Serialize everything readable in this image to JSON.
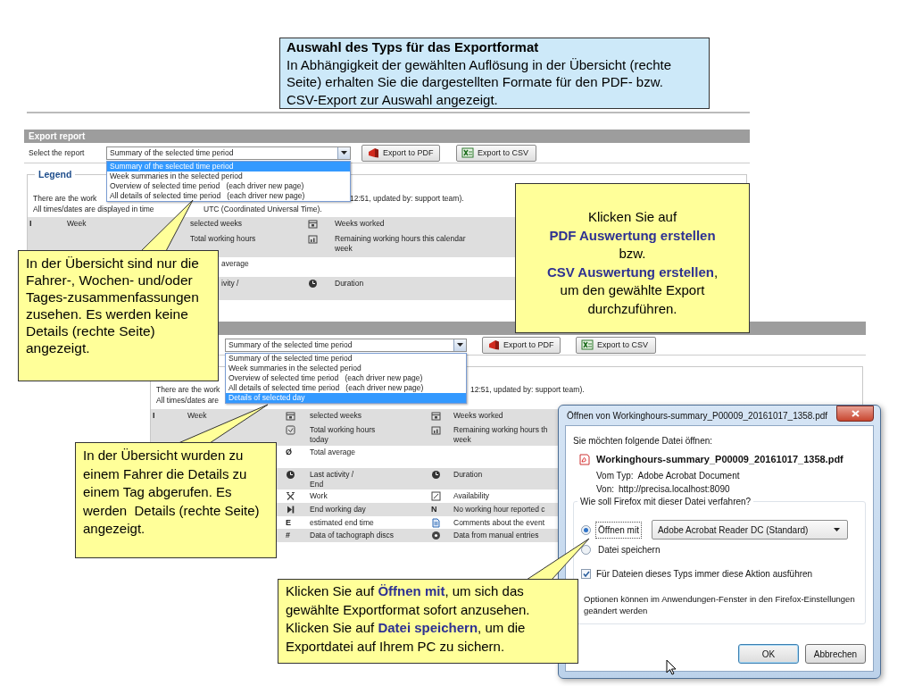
{
  "note": {
    "title": "Auswahl des Typs für das Exportformat",
    "text": "In Abhängigkeit der gewählten Auflösung in der Übersicht (rechte Seite) erhalten Sie die dargestellten Formate für den PDF- bzw. CSV-Export zur Auswahl angezeigt."
  },
  "screens": [
    {
      "header": "Export report",
      "select_label": "Select the report",
      "select_value": "Summary of the selected time period",
      "buttons": [
        {
          "kind": "pdf",
          "label": "Export to PDF"
        },
        {
          "kind": "csv",
          "label": "Export to CSV"
        }
      ],
      "dropdown": [
        {
          "label": "Summary of the selected time period",
          "selected": true
        },
        {
          "label": "Week summaries in the selected period",
          "selected": false
        },
        {
          "label": "Overview of selected time period   (each driver new page)",
          "selected": false
        },
        {
          "label": "All details of selected time period   (each driver new page)",
          "selected": false
        }
      ],
      "legend_title": "Legend",
      "info_lines": [
        [
          "There are the work",
          "12:51, updated by: support team)."
        ],
        [
          "All times/dates are displayed in time",
          "UTC (Coordinated Universal Time)."
        ]
      ],
      "rows": [
        {
          "shaded": true,
          "first": {
            "icon": {
              "kind": "glyph",
              "text": "I"
            },
            "label": "Week"
          },
          "second": {
            "label": "selected weeks"
          },
          "third": {
            "icon": {
              "kind": "calendar"
            },
            "label": "Weeks worked"
          }
        },
        {
          "shaded": true,
          "second": {
            "label": "Total working hours"
          },
          "third": {
            "icon": {
              "kind": "chart"
            },
            "label": "Remaining working hours this calendar\nweek"
          }
        },
        {
          "shaded": false,
          "second": {
            "label": "average"
          }
        },
        {
          "shaded": true,
          "second": {
            "label": "ivity /"
          },
          "third": {
            "icon": {
              "kind": "clock"
            },
            "label": "Duration"
          }
        }
      ]
    },
    {
      "select_value": "Summary of the selected time period",
      "buttons": [
        {
          "kind": "pdf",
          "label": "Export to PDF"
        },
        {
          "kind": "csv",
          "label": "Export to CSV"
        }
      ],
      "dropdown": [
        {
          "label": "Summary of the selected time period",
          "selected": false
        },
        {
          "label": "Week summaries in the selected period",
          "selected": false
        },
        {
          "label": "Overview of selected time period   (each driver new page)",
          "selected": false
        },
        {
          "label": "All details of selected time period   (each driver new page)",
          "selected": false
        },
        {
          "label": "Details of selected day",
          "selected": true
        }
      ],
      "info_lines": [
        [
          "There are the work",
          "12:51, updated by: support team)."
        ],
        [
          "All times/dates are"
        ]
      ],
      "rows": [
        {
          "shaded": true,
          "first": {
            "icon": {
              "kind": "glyph",
              "text": "I"
            },
            "label": "Week"
          },
          "second": {
            "icon": {
              "kind": "calendar"
            },
            "label": "selected weeks"
          },
          "third": {
            "icon": {
              "kind": "calendar"
            },
            "label": "Weeks worked"
          }
        },
        {
          "shaded": true,
          "second": {
            "icon": {
              "kind": "checkbox"
            },
            "label": "Total working hours\ntoday"
          },
          "third": {
            "icon": {
              "kind": "chart"
            },
            "label": "Remaining working hours th\nweek"
          }
        },
        {
          "shaded": false,
          "second": {
            "icon": {
              "kind": "glyph",
              "text": "Ø"
            },
            "label": "Total average"
          }
        },
        {
          "shaded": true,
          "second": {
            "icon": {
              "kind": "clock"
            },
            "label": "Last activity /\nEnd"
          },
          "third": {
            "icon": {
              "kind": "clock"
            },
            "label": "Duration"
          }
        },
        {
          "shaded": false,
          "second": {
            "icon": {
              "kind": "tools"
            },
            "label": "Work"
          },
          "third": {
            "icon": {
              "kind": "box"
            },
            "label": "Availability"
          }
        },
        {
          "shaded": true,
          "second": {
            "icon": {
              "kind": "end"
            },
            "label": "End working day"
          },
          "third": {
            "icon": {
              "kind": "glyph",
              "text": "N"
            },
            "label": "No working hour reported c"
          }
        },
        {
          "shaded": false,
          "second": {
            "icon": {
              "kind": "glyph",
              "text": "E"
            },
            "label": "estimated end time"
          },
          "third": {
            "icon": {
              "kind": "doc"
            },
            "label": "Comments about the event"
          }
        },
        {
          "shaded": true,
          "second": {
            "icon": {
              "kind": "glyph",
              "text": "#"
            },
            "label": "Data of tachograph discs"
          },
          "third": {
            "icon": {
              "kind": "disc"
            },
            "label": "Data from manual entries"
          }
        }
      ]
    }
  ],
  "dialog": {
    "title": "Öffnen von Workinghours-summary_P00009_20161017_1358.pdf",
    "prompt": "Sie möchten folgende Datei öffnen:",
    "file_name": "Workinghours-summary_P00009_20161017_1358.pdf",
    "type_label": "Vom Typ:",
    "type_value": "Adobe Acrobat Document",
    "from_label": "Von:",
    "from_value": "http://precisa.localhost:8090",
    "question": "Wie soll Firefox mit dieser Datei verfahren?",
    "options": [
      {
        "label": "Öffnen mit",
        "selected": true
      },
      {
        "label": "Datei speichern",
        "selected": false
      }
    ],
    "app_select": "Adobe Acrobat Reader DC  (Standard)",
    "remember": {
      "label": "Für Dateien dieses Typs immer diese Aktion ausführen",
      "checked": true
    },
    "hint": "Optionen können im Anwendungen-Fenster in den Firefox-Einstellungen geändert werden",
    "buttons": [
      "OK",
      "Abbrechen"
    ]
  },
  "callouts": [
    {
      "text": "In der Übersicht sind nur die Fahrer-, Wochen- und/oder Tages-zusammenfassungen zusehen. Es werden keine Details (rechte Seite) angezeigt."
    },
    {
      "text": "Klicken Sie auf **PDF Auswertung erstellen** bzw. **CSV Auswertung erstellen**, um den gewählte Export durchzuführen."
    },
    {
      "text": "In der Übersicht wurden zu einem Fahrer die Details zu einem Tag abgerufen. Es werden  Details (rechte Seite) angezeigt."
    },
    {
      "text": "Klicken Sie auf **Öffnen mit**, um sich das gewählte Exportformat sofort anzusehen. Klicken Sie auf **Datei speichern**, um die Exportdatei auf Ihrem PC zu sichern."
    }
  ]
}
